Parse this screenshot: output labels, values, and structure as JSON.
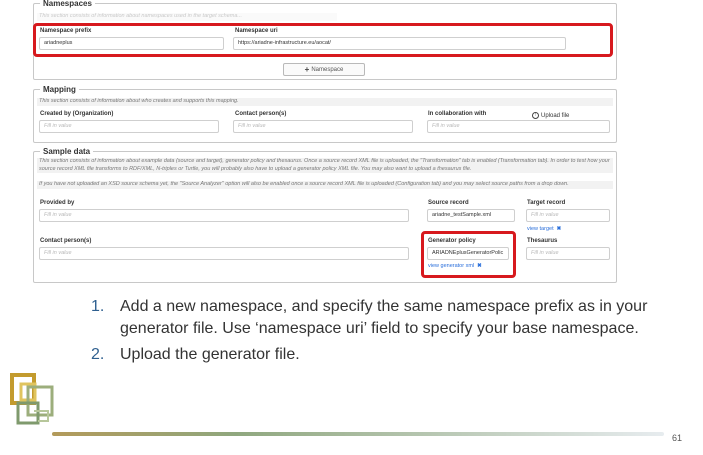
{
  "namespaces": {
    "legend": "Namespaces",
    "description": "This section consists of information about namespaces used in the target schema...",
    "prefix_label": "Namespace prefix",
    "prefix_value": "ariadneplus",
    "uri_label": "Namespace uri",
    "uri_value": "https://ariadne-infrastructure.eu/aocat/",
    "add_button": "Namespace"
  },
  "mapping": {
    "legend": "Mapping",
    "description": "This section consists of information about who creates and supports this mapping.",
    "created_by_label": "Created by (Organization)",
    "contact_label": "Contact person(s)",
    "collab_label": "In collaboration with",
    "placeholder": "Fill in value"
  },
  "sample": {
    "legend": "Sample data",
    "description_1": "This section consists of information about example data (source and target), generator policy and thesaurus. Once a source record XML file is uploaded, the \"Transformation\" tab is enabled (Transformation tab). In order to test how your source record XML file transforms to RDF/XML, N-triples or Turtle, you will probably also have to upload a generator policy XML file. You may also want to upload a thesaurus file.",
    "description_2": "If you have not uploaded an XSD source schema yet, the \"Source Analyzer\" option will also be enabled once a source record XML file is uploaded (Configuration tab) and you may select source paths from a drop down.",
    "provided_by_label": "Provided by",
    "source_record_label": "Source record",
    "source_record_value": "ariadne_testSample.xml",
    "target_record_label": "Target record",
    "view_target": "view target",
    "contact_label": "Contact person(s)",
    "generator_label": "Generator policy",
    "generator_value": "ARIADNEplusGeneratorPolic",
    "view_generator": "view generator xml",
    "thesaurus_label": "Thesaurus",
    "upload_file": "Upload file",
    "placeholder": "Fill in value"
  },
  "slide": {
    "bullets": [
      {
        "num": "1.",
        "text": "Add a new namespace, and specify the same namespace prefix as in your generator file. Use ‘namespace uri’ field to specify your base namespace."
      },
      {
        "num": "2.",
        "text": "Upload the generator file."
      }
    ],
    "page_number": "61"
  },
  "colors": {
    "highlight": "#d7191e",
    "link": "#2a6fdb",
    "bullet_number": "#2e5f8f",
    "logo_gold": "#c39b2e"
  }
}
